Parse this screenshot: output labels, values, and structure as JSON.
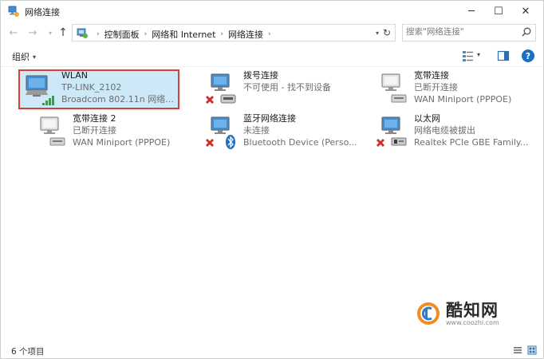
{
  "window": {
    "title": "网络连接",
    "minimize": "─",
    "maximize": "☐",
    "close": "✕"
  },
  "nav": {
    "back": "←",
    "forward": "→",
    "recent": "▾",
    "up": "↑",
    "breadcrumbs": [
      "控制面板",
      "网络和 Internet",
      "网络连接"
    ],
    "separator": "›",
    "refresh": "↻",
    "search_placeholder": "搜索\"网络连接\""
  },
  "toolbar": {
    "organize_label": "组织",
    "organize_caret": "▾",
    "view_caret": "▾",
    "help": "?"
  },
  "connections": [
    {
      "name": "WLAN",
      "status": "TP-LINK_2102",
      "device": "Broadcom 802.11n 网络...",
      "icon": "wifi-adapter-icon",
      "selected": true
    },
    {
      "name": "拨号连接",
      "status": "不可使用 - 找不到设备",
      "device": "",
      "icon": "dialup-adapter-icon",
      "disconnected": true
    },
    {
      "name": "宽带连接",
      "status": "已断开连接",
      "device": "WAN Miniport (PPPOE)",
      "icon": "broadband-adapter-icon"
    },
    {
      "name": "宽带连接 2",
      "status": "已断开连接",
      "device": "WAN Miniport (PPPOE)",
      "icon": "broadband-adapter-icon"
    },
    {
      "name": "蓝牙网络连接",
      "status": "未连接",
      "device": "Bluetooth Device (Perso...",
      "icon": "bluetooth-adapter-icon",
      "disconnected": true
    },
    {
      "name": "以太网",
      "status": "网络电缆被拔出",
      "device": "Realtek PCIe GBE Family...",
      "icon": "ethernet-adapter-icon",
      "disconnected": true
    }
  ],
  "watermark": {
    "name": "酷知网",
    "url": "www.coozhi.com"
  },
  "statusbar": {
    "count": "6 个项目"
  },
  "colors": {
    "selection": "#cde8f7",
    "highlight_border": "#d9403c",
    "monitor_blue": "#3f8fd6",
    "disconnect_red": "#d0312d",
    "signal_green": "#2fa62f"
  }
}
